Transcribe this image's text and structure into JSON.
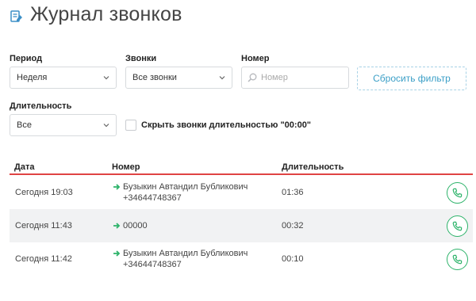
{
  "header": {
    "title": "Журнал звонков",
    "icon": "call-log-icon"
  },
  "filters": {
    "period": {
      "label": "Период",
      "value": "Неделя"
    },
    "calls": {
      "label": "Звонки",
      "value": "Все звонки"
    },
    "number": {
      "label": "Номер",
      "placeholder": "Номер"
    },
    "reset_label": "Сбросить фильтр",
    "duration": {
      "label": "Длительность",
      "value": "Все"
    },
    "hide_zero": {
      "label": "Скрыть звонки длительностью \"00:00\"",
      "checked": false
    }
  },
  "table": {
    "columns": [
      "Дата",
      "Номер",
      "Длительность"
    ],
    "rows": [
      {
        "date": "Сегодня 19:03",
        "name": "Бузыкин Автандил Бубликович",
        "phone": "+34644748367",
        "duration": "01:36"
      },
      {
        "date": "Сегодня 11:43",
        "name": "00000",
        "phone": "",
        "duration": "00:32"
      },
      {
        "date": "Сегодня 11:42",
        "name": "Бузыкин Автандил Бубликович",
        "phone": "+34644748367",
        "duration": "00:10"
      }
    ]
  },
  "colors": {
    "accent_red": "#e04444",
    "call_green": "#2db36a",
    "reset_blue": "#3b9fc7"
  }
}
